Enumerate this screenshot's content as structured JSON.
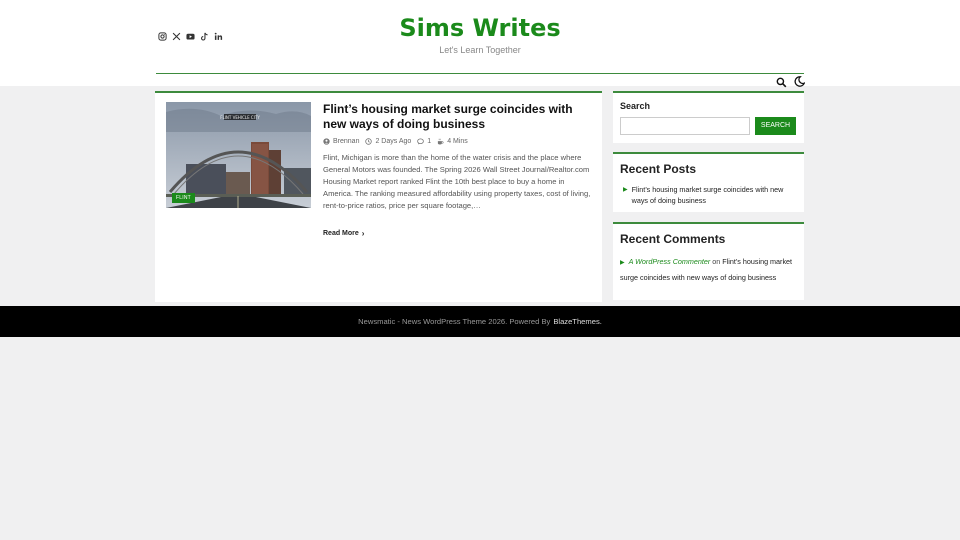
{
  "site": {
    "title": "Sims Writes",
    "tagline": "Let's Learn Together",
    "accent_color": "#1b8a1b"
  },
  "header": {
    "social_icons": [
      "instagram-icon",
      "x-icon",
      "youtube-icon",
      "tiktok-icon",
      "linkedin-icon"
    ],
    "utility_icons": [
      "search-icon",
      "moon-icon"
    ]
  },
  "post": {
    "category": "FLINT",
    "title": "Flint’s housing market surge coincides with new ways of doing business",
    "author": "Brennan",
    "date": "2 Days Ago",
    "comments": "1",
    "read_time": "4 Mins",
    "excerpt": "Flint, Michigan is more than the home of the water crisis and the place where General Motors was founded. The Spring 2026 Wall Street Journal/Realtor.com Housing Market report ranked Flint the 10th best place to buy a home in America. The ranking measured affordability using property taxes, cost of living, rent-to-price ratios, price per square footage,…",
    "read_more": "Read More",
    "image_sign_text": "FLINT VEHICLE CITY"
  },
  "sidebar": {
    "search": {
      "title": "Search",
      "button": "SEARCH",
      "value": ""
    },
    "recent_posts": {
      "title": "Recent Posts",
      "items": [
        "Flint’s housing market surge coincides with new ways of doing business"
      ]
    },
    "recent_comments": {
      "title": "Recent Comments",
      "items": [
        {
          "author": "A WordPress Commenter",
          "on": "on",
          "post": "Flint’s housing market surge coincides with new ways of doing business"
        }
      ]
    }
  },
  "footer": {
    "text": "Newsmatic - News WordPress Theme 2026. Powered By",
    "brand": "BlazeThemes."
  }
}
